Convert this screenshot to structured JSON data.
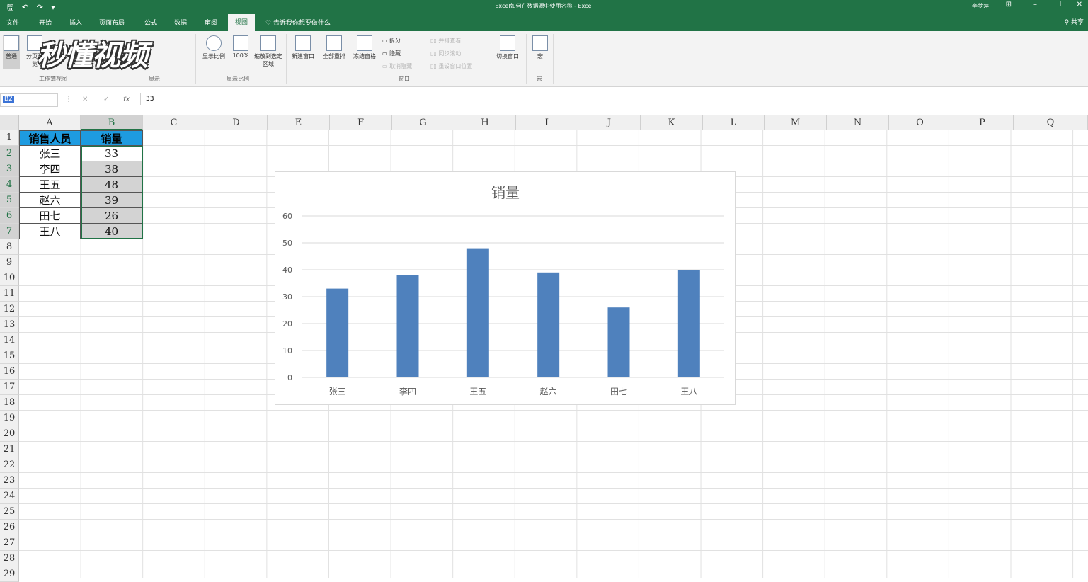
{
  "titlebar": {
    "qat": "🖫 ↶ ↷ ▾",
    "title": "Excel如何在数据源中使用名称 - Excel",
    "user": "李梦萍"
  },
  "tabs": [
    "文件",
    "开始",
    "插入",
    "页面布局",
    "公式",
    "数据",
    "审阅",
    "视图"
  ],
  "active_tab": "视图",
  "tell_me": "告诉我你想要做什么",
  "share": "共享",
  "ribbon": {
    "normal": "普通",
    "pagebreak": "分页预览",
    "group_workbook_views": "工作簿视图",
    "group_show": "显示",
    "zoom": "显示比例",
    "zoom100": "100%",
    "zoom_selection": "缩放到选定区域",
    "group_zoom": "显示比例",
    "new_window": "新建窗口",
    "arrange_all": "全部重排",
    "freeze_panes": "冻结窗格",
    "split": "拆分",
    "hide": "隐藏",
    "unhide": "取消隐藏",
    "side_by_side": "并排查看",
    "sync_scroll": "同步滚动",
    "reset_pos": "重设窗口位置",
    "switch_windows": "切换窗口",
    "group_window": "窗口",
    "macros": "宏",
    "group_macros": "宏"
  },
  "watermark": "秒懂视频",
  "formula_bar": {
    "name_box": "B2",
    "cancel": "✕",
    "enter": "✓",
    "fx": "fx",
    "value": "33"
  },
  "columns": [
    "A",
    "B",
    "C",
    "D",
    "E",
    "F",
    "G",
    "H",
    "I",
    "J",
    "K",
    "L",
    "M",
    "N",
    "O",
    "P",
    "Q"
  ],
  "rows": [
    "1",
    "2",
    "3",
    "4",
    "5",
    "6",
    "7",
    "8",
    "9",
    "10",
    "11",
    "12",
    "13",
    "14",
    "15",
    "16",
    "17",
    "18",
    "19",
    "20",
    "21",
    "22",
    "23",
    "24",
    "25",
    "26",
    "27",
    "28",
    "29"
  ],
  "table": {
    "headers": [
      "销售人员",
      "销量"
    ],
    "rows": [
      [
        "张三",
        "33"
      ],
      [
        "李四",
        "38"
      ],
      [
        "王五",
        "48"
      ],
      [
        "赵六",
        "39"
      ],
      [
        "田七",
        "26"
      ],
      [
        "王八",
        "40"
      ]
    ]
  },
  "chart_data": {
    "type": "bar",
    "title": "销量",
    "categories": [
      "张三",
      "李四",
      "王五",
      "赵六",
      "田七",
      "王八"
    ],
    "values": [
      33,
      38,
      48,
      39,
      26,
      40
    ],
    "ylim": [
      0,
      60
    ],
    "yticks": [
      0,
      10,
      20,
      30,
      40,
      50,
      60
    ],
    "grid": true,
    "bar_color": "#4f81bd"
  }
}
